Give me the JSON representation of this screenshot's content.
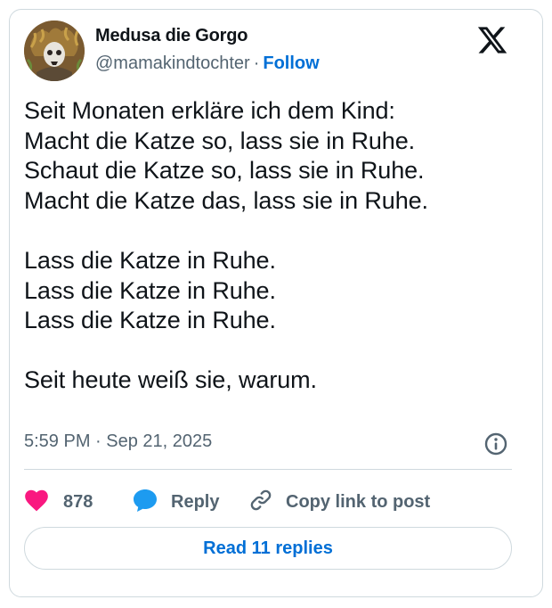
{
  "author": {
    "name": "Medusa die Gorgo",
    "handle": "@mamakindtochter",
    "separator": "·",
    "follow_label": "Follow"
  },
  "tweet": {
    "lines": [
      "Seit Monaten erkläre ich dem Kind:",
      "Macht die Katze so, lass sie in Ruhe.",
      "Schaut die Katze so, lass sie in Ruhe.",
      "Macht die Katze das, lass sie in Ruhe.",
      "",
      "Lass die Katze in Ruhe.",
      "Lass die Katze in Ruhe.",
      "Lass die Katze in Ruhe.",
      "",
      "Seit heute weiß sie, warum."
    ],
    "timestamp": "5:59 PM · Sep 21, 2025"
  },
  "actions": {
    "like_count": "878",
    "reply_label": "Reply",
    "copy_link_label": "Copy link to post"
  },
  "footer": {
    "read_replies_label": "Read 11 replies"
  },
  "colors": {
    "text": "#0f1419",
    "secondary": "#536471",
    "link": "#006fd6",
    "like": "#f91880",
    "reply_bubble": "#1d9bf0",
    "border": "#cfd9de"
  },
  "icons": {
    "brand": "x-logo-icon",
    "info": "info-icon",
    "like": "heart-icon",
    "reply": "speech-bubble-icon",
    "copy": "link-icon"
  }
}
